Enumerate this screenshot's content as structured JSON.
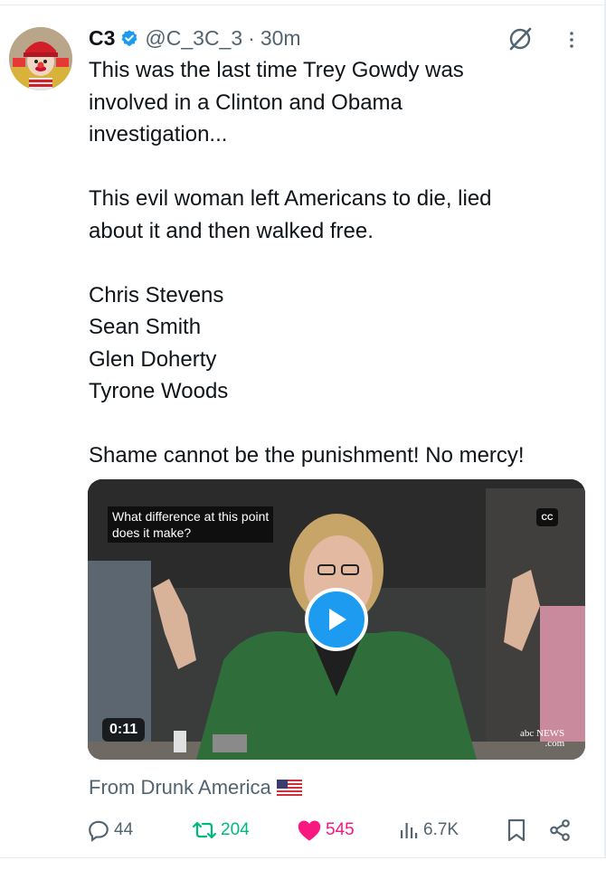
{
  "tweet": {
    "display_name": "C3",
    "handle": "@C_3C_3",
    "separator": "·",
    "time": "30m",
    "text_lines": [
      "This was the last time Trey Gowdy was",
      "involved in a Clinton and Obama",
      "investigation...",
      "",
      "This evil woman left Americans to die, lied",
      "about it and then walked free.",
      "",
      "Chris Stevens",
      "Sean Smith",
      "Glen Doherty",
      "Tyrone Woods",
      "",
      "Shame cannot be the punishment! No mercy!"
    ]
  },
  "media": {
    "caption_line1": "What difference at this point",
    "caption_line2": "does it make?",
    "cc_label": "CC",
    "duration": "0:11",
    "logo_line1": "abc NEWS",
    "logo_line2": ".com"
  },
  "source": {
    "text": "From Drunk America",
    "flag_icon": "us-flag-icon"
  },
  "metrics": {
    "replies": "44",
    "reposts": "204",
    "likes": "545",
    "views": "6.7K"
  },
  "colors": {
    "accent": "#1d9bf0",
    "repost": "#00ba7c",
    "like": "#f91880",
    "muted": "#536471",
    "text": "#0f1419"
  },
  "icons": {
    "verified": "verified-badge-icon",
    "grok": "grok-icon",
    "more": "more-dots-icon",
    "reply": "reply-icon",
    "repost": "repost-icon",
    "like": "heart-icon",
    "views": "views-chart-icon",
    "bookmark": "bookmark-icon",
    "share": "share-icon",
    "play": "play-icon"
  }
}
